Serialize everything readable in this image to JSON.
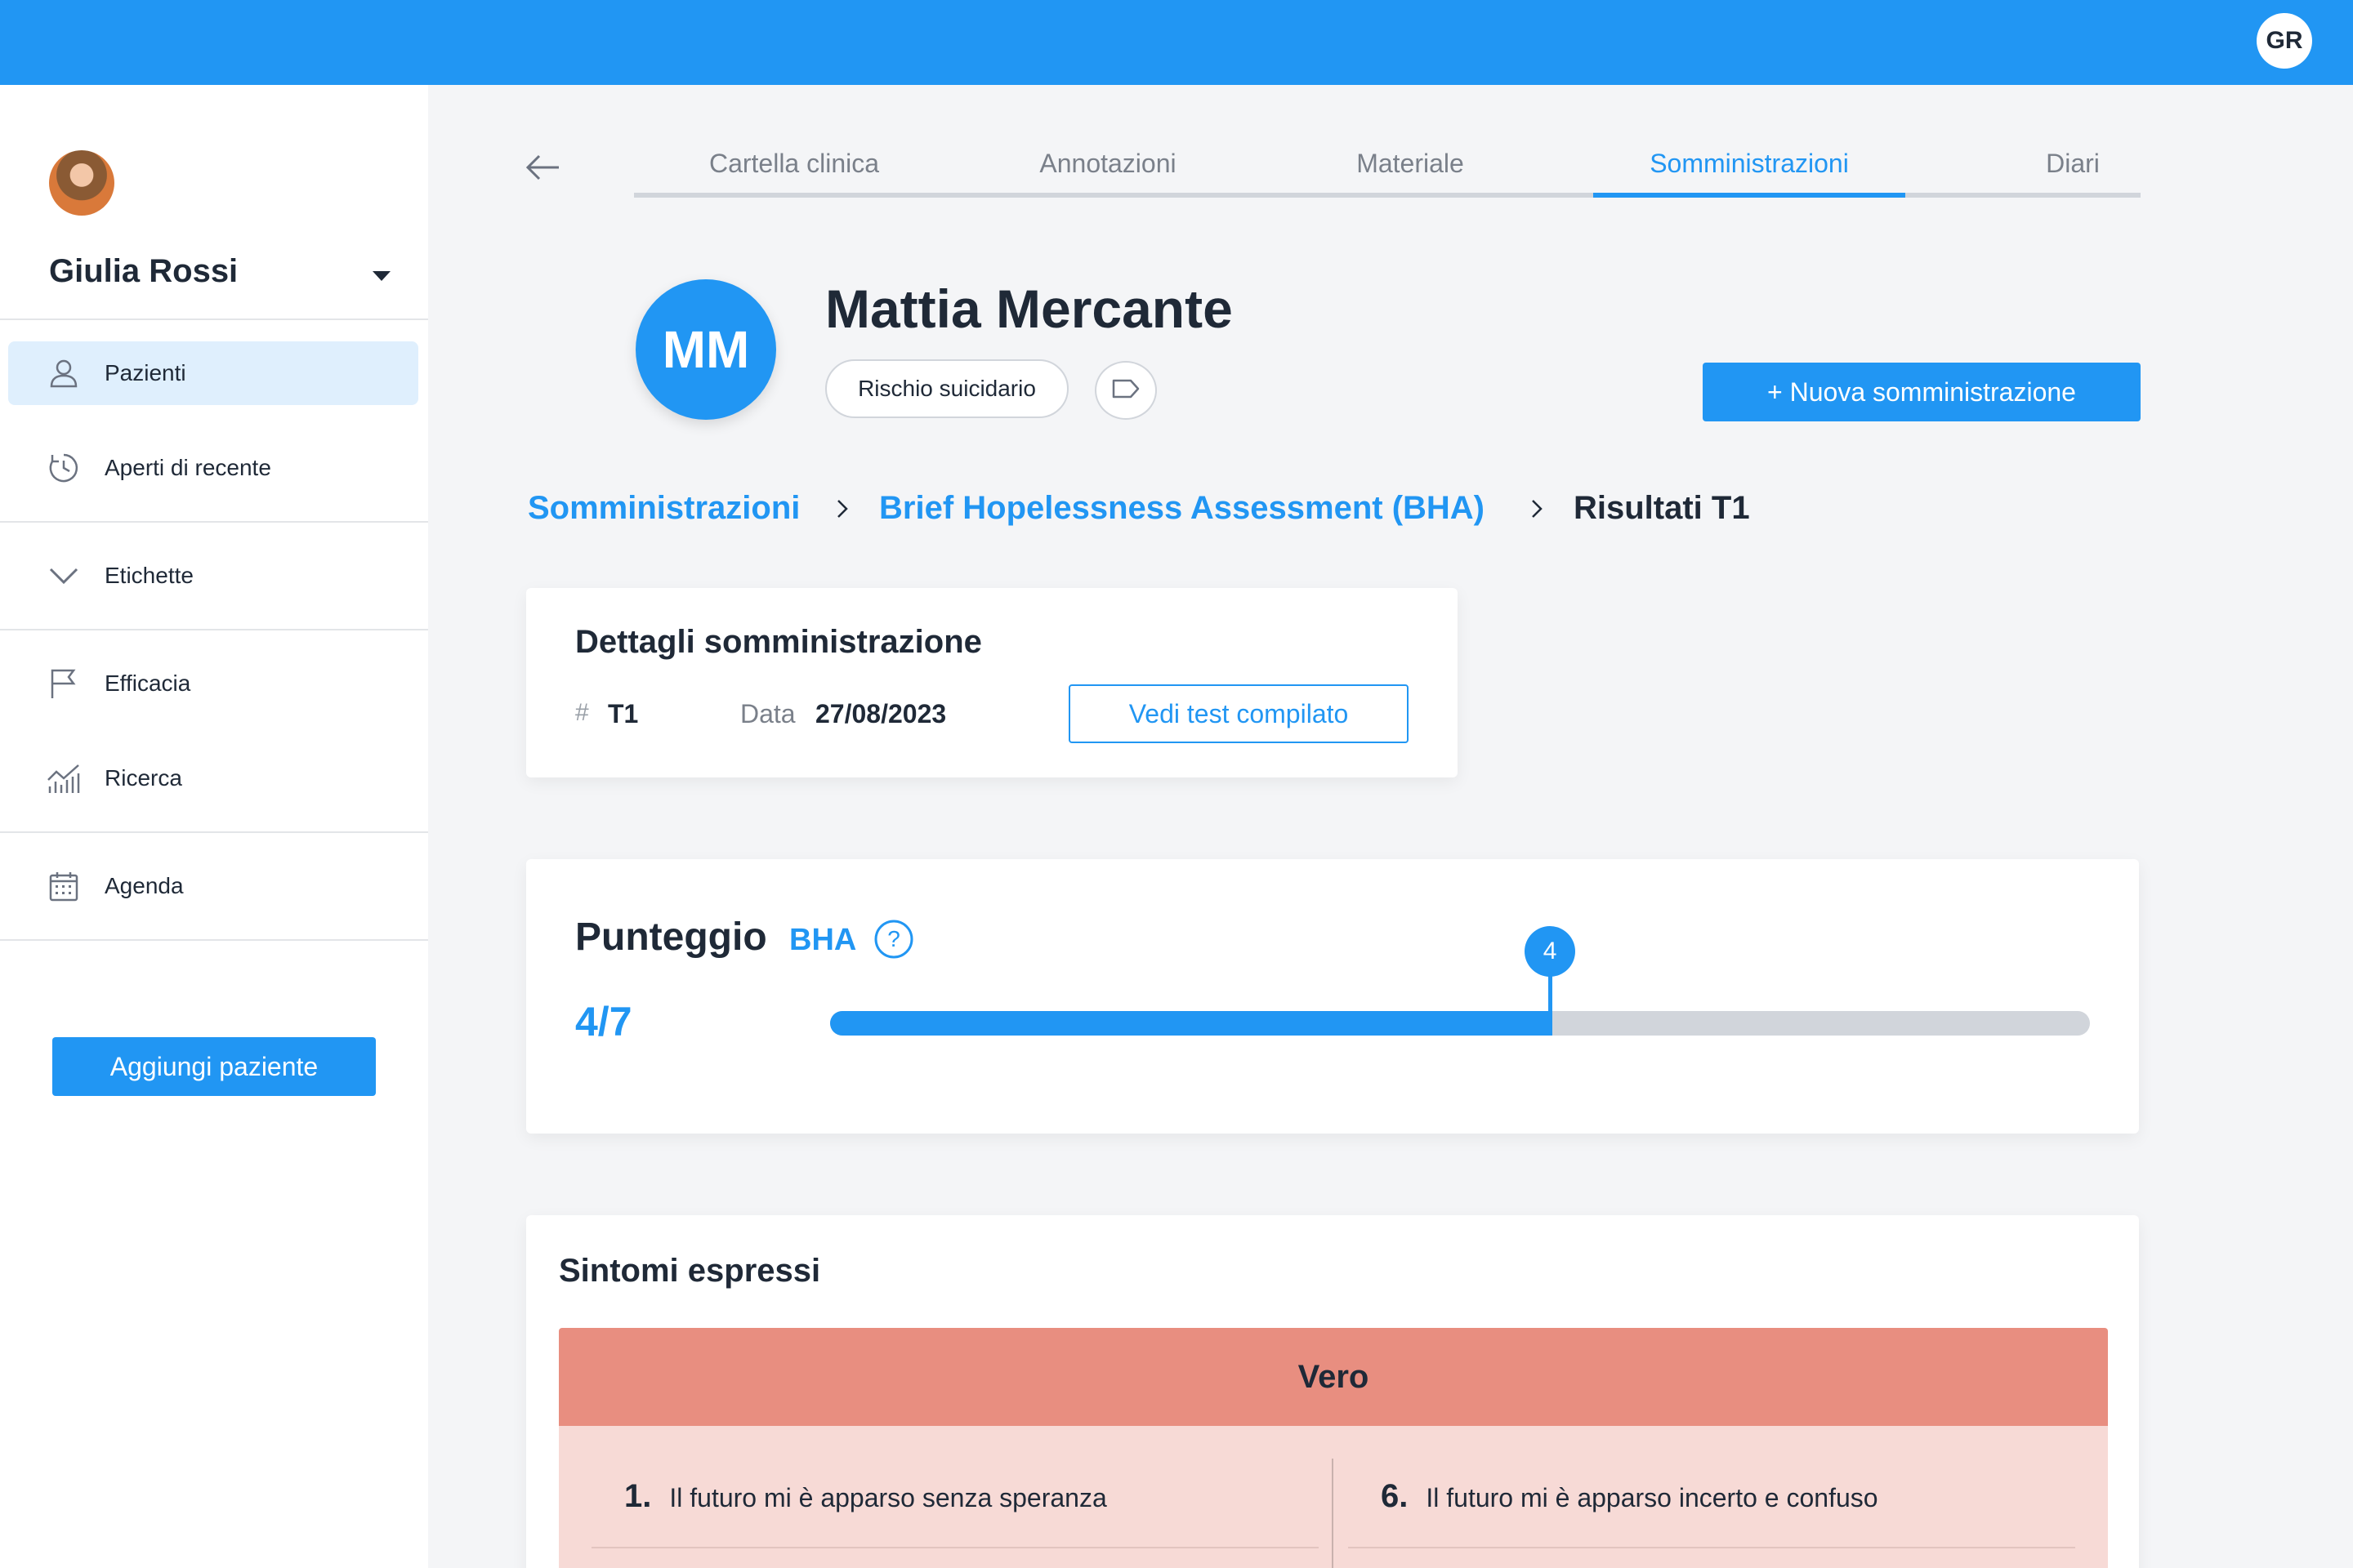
{
  "header": {
    "user_initials": "GR",
    "accent_color": "#2196f3"
  },
  "sidebar": {
    "doctor_name": "Giulia Rossi",
    "items": [
      {
        "label": "Pazienti",
        "icon": "user-icon",
        "active": true
      },
      {
        "label": "Aperti di recente",
        "icon": "clock-icon",
        "active": false
      },
      {
        "label": "Etichette",
        "icon": "chevron-down-icon",
        "active": false
      },
      {
        "label": "Efficacia",
        "icon": "flag-icon",
        "active": false
      },
      {
        "label": "Ricerca",
        "icon": "chart-icon",
        "active": false
      },
      {
        "label": "Agenda",
        "icon": "calendar-icon",
        "active": false
      }
    ],
    "add_button": "Aggiungi paziente"
  },
  "tabs": [
    {
      "label": "Cartella clinica",
      "active": false
    },
    {
      "label": "Annotazioni",
      "active": false
    },
    {
      "label": "Materiale",
      "active": false
    },
    {
      "label": "Somministrazioni",
      "active": true
    },
    {
      "label": "Diari",
      "active": false
    }
  ],
  "patient": {
    "initials": "MM",
    "name": "Mattia Mercante",
    "tags": [
      "Rischio suicidario"
    ],
    "new_button": "+  Nuova somministrazione"
  },
  "breadcrumb": {
    "items": [
      "Somministrazioni",
      "Brief Hopelessness Assessment (BHA)",
      "Risultati T1"
    ]
  },
  "details": {
    "title": "Dettagli somministrazione",
    "hash_symbol": "#",
    "id_value": "T1",
    "date_label": "Data",
    "date_value": "27/08/2023",
    "view_button": "Vedi test compilato"
  },
  "score": {
    "title": "Punteggio",
    "scale": "BHA",
    "display": "4/7",
    "value": 4,
    "max": 7,
    "marker_label": "4"
  },
  "symptoms": {
    "title": "Sintomi espressi",
    "group_label": "Vero",
    "group_color": "#e88e80",
    "items": [
      {
        "num": "1.",
        "text": "Il futuro mi è apparso senza speranza"
      },
      {
        "num": "6.",
        "text": "Il futuro mi è apparso incerto e confuso"
      }
    ]
  }
}
